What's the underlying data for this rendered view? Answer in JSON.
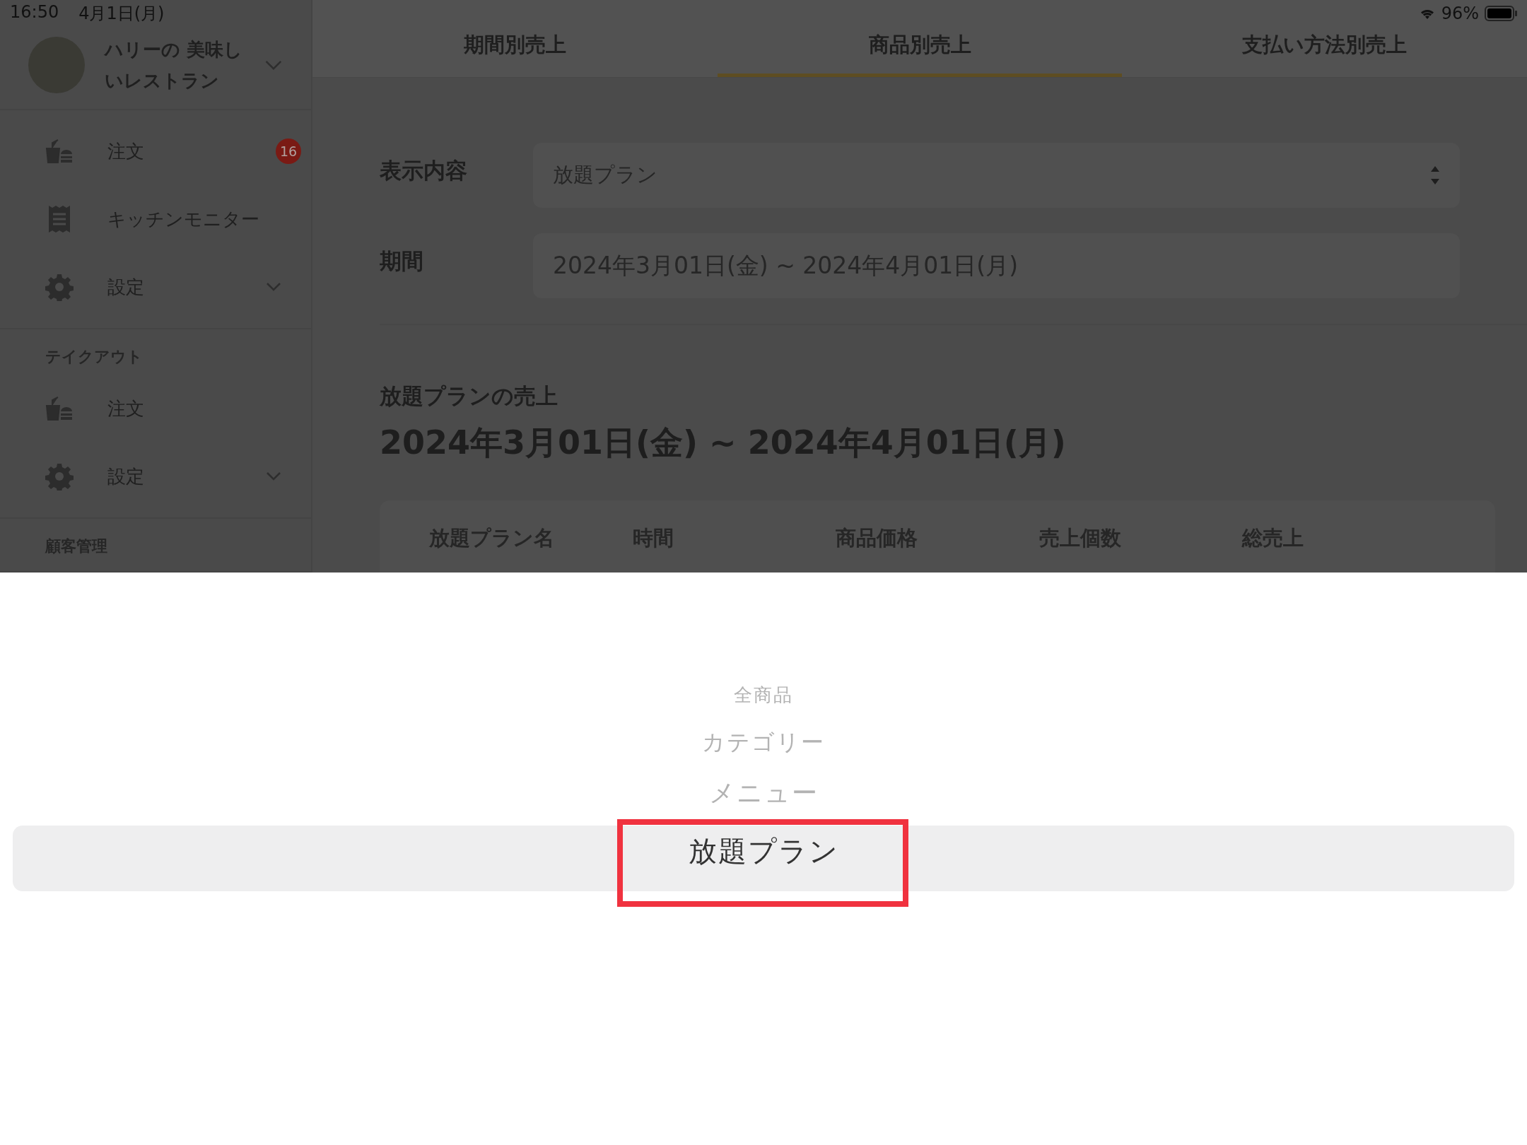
{
  "status_bar": {
    "time": "16:50",
    "date": "4月1日(月)",
    "battery": "96%"
  },
  "sidebar": {
    "restaurant_name": "ハリーの 美味しいレストラン",
    "sections": [
      {
        "items": [
          {
            "kind": "order",
            "label": "注文",
            "badge": "16"
          },
          {
            "kind": "kitchen",
            "label": "キッチンモニター"
          },
          {
            "kind": "settings",
            "label": "設定",
            "expanded": false
          }
        ]
      },
      {
        "title": "テイクアウト",
        "items": [
          {
            "kind": "order",
            "label": "注文"
          },
          {
            "kind": "settings",
            "label": "設定",
            "expanded": false
          }
        ]
      },
      {
        "title": "顧客管理"
      }
    ]
  },
  "tabs": [
    {
      "label": "期間別売上",
      "selected": false
    },
    {
      "label": "商品別売上",
      "selected": true
    },
    {
      "label": "支払い方法別売上",
      "selected": false
    }
  ],
  "form": [
    {
      "kind": "select",
      "label": "表示内容",
      "value": "放題プラン"
    },
    {
      "kind": "text",
      "label": "期間",
      "value": "2024年3月01日(金) ~ 2024年4月01日(月)"
    }
  ],
  "report": {
    "subtitle": "放題プランの売上",
    "title": "2024年3月01日(金) ~ 2024年4月01日(月)",
    "columns": [
      "放題プラン名",
      "時間",
      "商品価格",
      "売上個数",
      "総売上"
    ]
  },
  "picker": {
    "options": [
      {
        "label": "全商品",
        "selected": false
      },
      {
        "label": "カテゴリー",
        "selected": false
      },
      {
        "label": "メニュー",
        "selected": false
      },
      {
        "label": "放題プラン",
        "selected": true
      }
    ]
  }
}
